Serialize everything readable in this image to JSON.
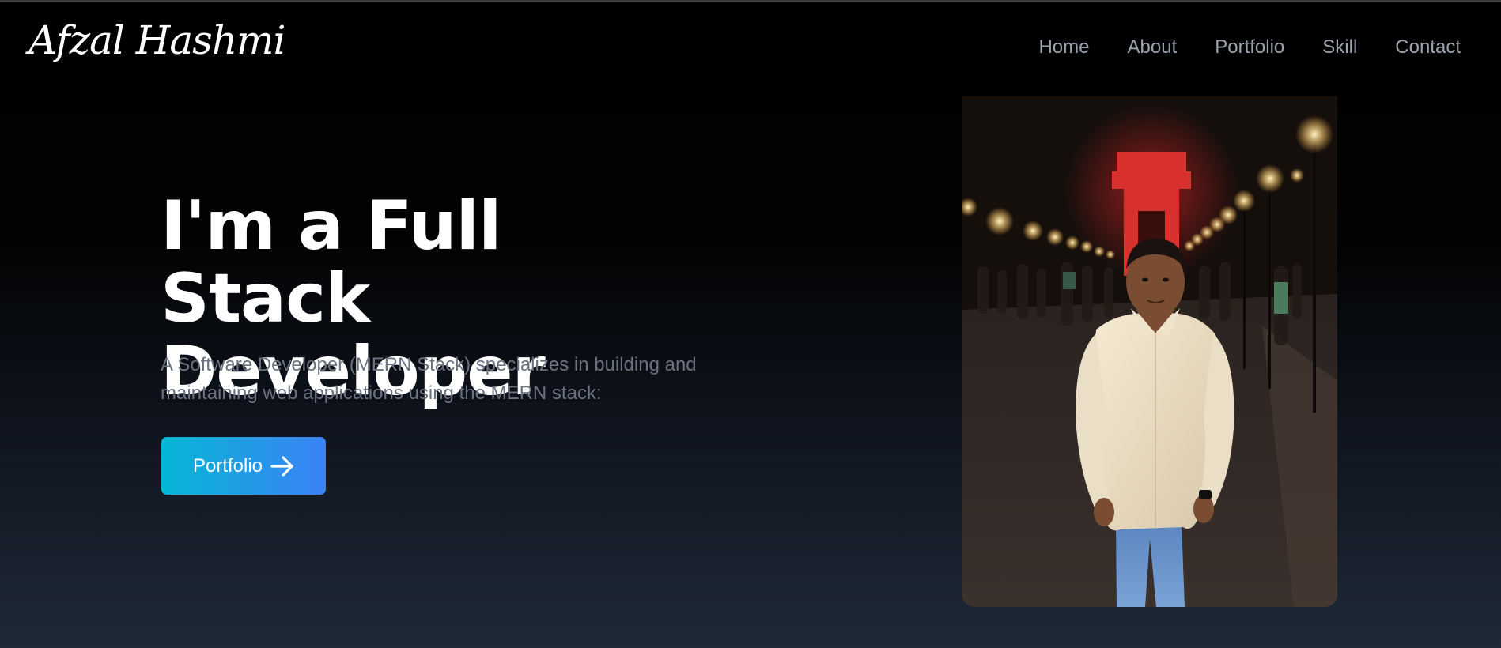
{
  "brand": {
    "logo_text": "Afzal Hashmi"
  },
  "nav": {
    "items": [
      {
        "label": "Home"
      },
      {
        "label": "About"
      },
      {
        "label": "Portfolio"
      },
      {
        "label": "Skill"
      },
      {
        "label": "Contact"
      }
    ]
  },
  "hero": {
    "title": "I'm a Full Stack Developer",
    "description": "A Software Developer (MERN Stack) specializes in building and maintaining web applications using the MERN stack:",
    "cta_label": "Portfolio",
    "cta_icon": "arrow-right-icon"
  },
  "colors": {
    "nav_text": "#9ca3af",
    "description_text": "#6b7280",
    "button_gradient_start": "#06b6d4",
    "button_gradient_end": "#3b82f6",
    "background_top": "#000000",
    "background_bottom": "#1f2937"
  }
}
